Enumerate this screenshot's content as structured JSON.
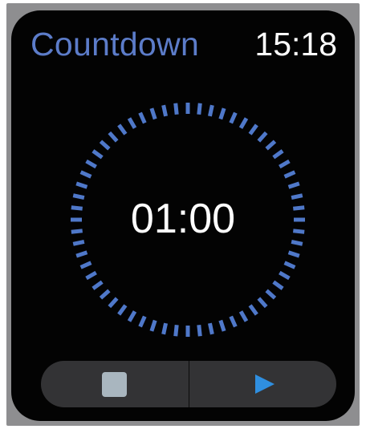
{
  "header": {
    "title": "Countdown",
    "clock": "15:18"
  },
  "timer": {
    "display": "01:00",
    "tick_color": "#4f78c9",
    "tick_count": 60
  },
  "controls": {
    "stop_icon": "stop-icon",
    "play_icon": "play-icon",
    "stop_color": "#a9b6bf",
    "play_color": "#2f8fe0"
  },
  "colors": {
    "accent": "#5c7cc9",
    "background": "#030303",
    "control_bar": "#333335"
  }
}
